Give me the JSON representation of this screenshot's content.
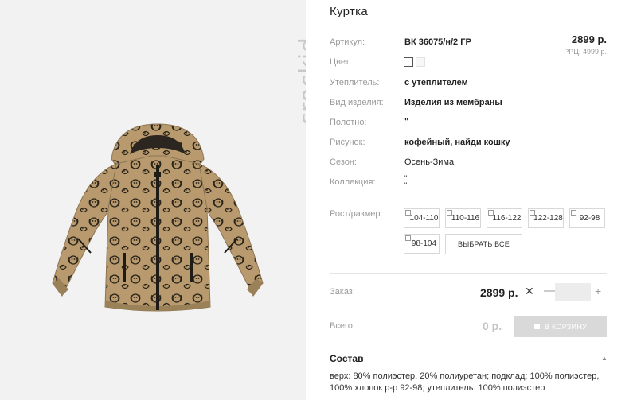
{
  "brand": {
    "logo_text": "crockid"
  },
  "product": {
    "title": "Куртка",
    "price": "2899 р.",
    "rrp": "РРЦ: 4999 р."
  },
  "attributes": [
    {
      "label": "Артикул:",
      "value": "ВК 36075/н/2 ГР"
    },
    {
      "label": "Цвет:",
      "value": ""
    },
    {
      "label": "Утеплитель:",
      "value": "с утеплителем"
    },
    {
      "label": "Вид изделия:",
      "value": "Изделия из мембраны"
    },
    {
      "label": "Полотно:",
      "value": "\""
    },
    {
      "label": "Рисунок:",
      "value": "кофейный, найди кошку"
    },
    {
      "label": "Сезон:",
      "value": "Осень-Зима"
    },
    {
      "label": "Коллекция:",
      "value": "\"\n\""
    }
  ],
  "sizes": {
    "label": "Рост/размер:",
    "options": [
      "104-110",
      "110-116",
      "116-122",
      "122-128",
      "92-98",
      "98-104"
    ],
    "select_all": "ВЫБРАТЬ ВСЕ"
  },
  "order": {
    "label": "Заказ:",
    "price": "2899 р.",
    "remove": "✕",
    "minus": "—",
    "plus": "+",
    "quantity": ""
  },
  "total": {
    "label": "Всего:",
    "value": "0 р.",
    "cart_button": "В КОРЗИНУ"
  },
  "composition": {
    "title": "Состав",
    "chevron": "▲",
    "text": "верх: 80% полиэстер, 20% полиуретан; подклад: 100% полиэстер, 100% хлопок р-р 92-98; утеплитель: 100% полиэстер"
  },
  "colors": {
    "jacket": "#b89a6e",
    "pattern": "#2a2419",
    "background": "#f2f2f2",
    "cart_disabled": "#d9d9d9"
  }
}
